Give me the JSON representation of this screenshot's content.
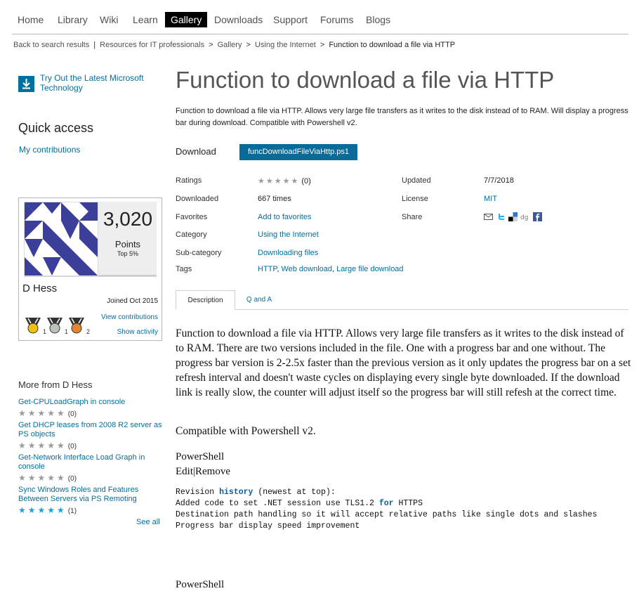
{
  "nav": {
    "items": [
      "Home",
      "Library",
      "Wiki",
      "Learn",
      "Gallery",
      "Downloads",
      "Support",
      "Forums",
      "Blogs"
    ],
    "active": "Gallery"
  },
  "breadcrumb": {
    "back": "Back to search results",
    "links": [
      "Resources for IT professionals",
      "Gallery",
      "Using the Internet"
    ],
    "current": "Function to download a file via HTTP"
  },
  "sidebar": {
    "promo": "Try Out the Latest Microsoft Technology",
    "quick_access_title": "Quick access",
    "my_contributions": "My contributions",
    "profile": {
      "points": "3,020",
      "points_label": "Points",
      "top": "Top 5%",
      "name": "D Hess",
      "joined": "Joined Oct 2015",
      "view_contributions": "View contributions",
      "show_activity": "Show activity",
      "medals": [
        {
          "color": "#f2c10f",
          "count": "1"
        },
        {
          "color": "#b9c3b9",
          "count": "1"
        },
        {
          "color": "#e3862f",
          "count": "2"
        }
      ]
    },
    "more_title": "More from D Hess",
    "more_items": [
      {
        "title": "Get-CPULoadGraph in console",
        "stars": "★★★★★",
        "rating": "(0)"
      },
      {
        "title": "Get DHCP leases from 2008 R2 server as PS objects",
        "stars": "★★★★★",
        "rating": "(0)"
      },
      {
        "title": "Get-Network Interface Load Graph in console",
        "stars": "★★★★★",
        "rating": "(0)"
      },
      {
        "title": "Sync Windows Roles and Features Between Servers via PS Remoting",
        "stars": "★★★★★",
        "rating": "(1)"
      }
    ],
    "see_all": "See all"
  },
  "main": {
    "title": "Function to download a file via HTTP",
    "summary": "Function to download a file via HTTP.  Allows very large file transfers as it writes to the disk instead of to RAM.  Will display a progress bar during download.  Compatible with Powershell v2.",
    "download_label": "Download",
    "download_file": "funcDownloadFileViaHttp.ps1",
    "meta": {
      "ratings_label": "Ratings",
      "ratings_stars": "★★★★★",
      "ratings_count": "(0)",
      "updated_label": "Updated",
      "updated": "7/7/2018",
      "downloaded_label": "Downloaded",
      "downloaded": "667 times",
      "license_label": "License",
      "license": "MIT",
      "favorites_label": "Favorites",
      "favorites": "Add to favorites",
      "share_label": "Share",
      "category_label": "Category",
      "category": "Using the Internet",
      "subcategory_label": "Sub-category",
      "subcategory": "Downloading files",
      "tags_label": "Tags",
      "tags": [
        "HTTP",
        "Web download",
        "Large file download"
      ]
    },
    "tabs": [
      "Description",
      "Q and A"
    ],
    "description": "Function to download a file via HTTP.  Allows very large file transfers as it writes to the disk instead of to RAM.  There are two versions included in the file.  One with a progress bar and one without.  The progress bar version is 2-2.5x faster than the previous version as it only updates the progress bar on a set refresh interval and doesn't waste cycles on displaying every single byte downloaded.  If the download link is really slow, the counter will adjust itself so the progress bar will still refesh at the correct time.",
    "compat": "Compatible with Powershell v2.",
    "ps_label": "PowerShell",
    "edit": "Edit",
    "edit_sep": "|",
    "remove": "Remove",
    "code": {
      "l1a": "Revision ",
      "l1kw": "history",
      "l1b": " (newest at top):",
      "l2a": "Added code to set .NET session use TLS1.2 ",
      "l2kw": "for",
      "l2b": " HTTPS",
      "l3": "Destination path handling so it will accept relative paths like single dots and slashes",
      "l4": "Progress bar display speed improvement"
    },
    "ps_label2": "PowerShell"
  }
}
